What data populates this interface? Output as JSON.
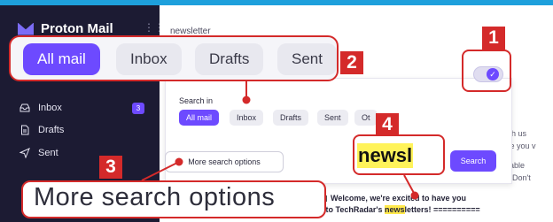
{
  "app": {
    "name": "Proton Mail",
    "accent": "#6d4aff",
    "annotation_color": "#d42a2a"
  },
  "sidebar": {
    "items": [
      {
        "label": "Inbox",
        "icon": "inbox-icon",
        "count": "3"
      },
      {
        "label": "Drafts",
        "icon": "drafts-icon"
      },
      {
        "label": "Sent",
        "icon": "sent-icon"
      }
    ]
  },
  "search": {
    "query": "newsletter",
    "search_in_label": "Search in",
    "scopes": [
      "All mail",
      "Inbox",
      "Drafts",
      "Sent",
      "Ot"
    ],
    "selected_scope": "All mail",
    "more_options_label": "More search options",
    "search_button": "Search"
  },
  "mail_snippets": [
    "with us",
    "ave you v",
    "ailable",
    "y? Don't"
  ],
  "message": {
    "line1": "Welcome, we're excited to have you",
    "line2_pre": "...to TechRadar's ",
    "line2_hl": "news",
    "line2_post": "letters! =========="
  },
  "callouts": {
    "badges": [
      "1",
      "2",
      "3",
      "4"
    ],
    "tabs": [
      "All mail",
      "Inbox",
      "Drafts",
      "Sent"
    ],
    "zoom_input": "newsl",
    "zoom_more": "More search options"
  }
}
